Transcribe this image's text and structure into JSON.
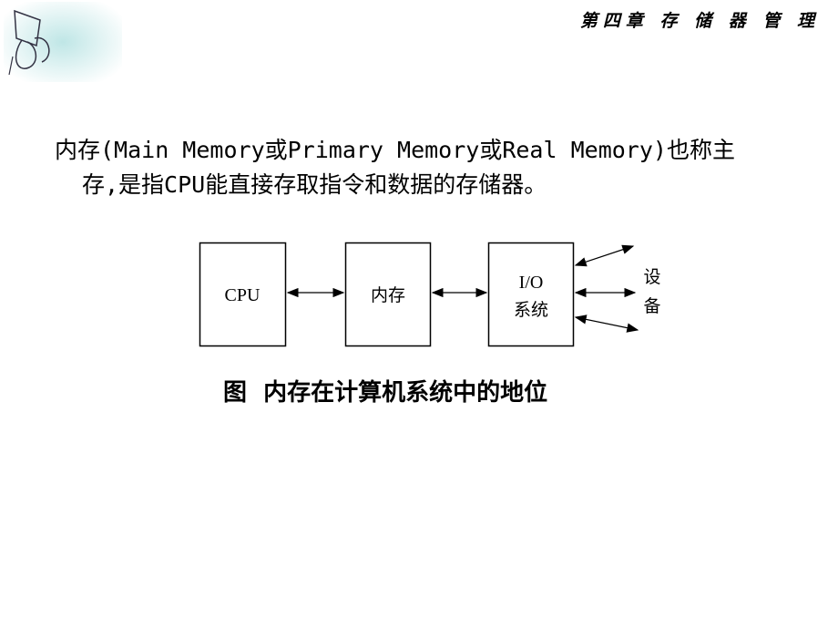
{
  "header": {
    "chapter_title": "第四章 存 储 器 管 理"
  },
  "body": {
    "line1": "内存(Main Memory或Primary Memory或Real Memory)也称主",
    "line2": "存,是指CPU能直接存取指令和数据的存储器。"
  },
  "diagram": {
    "cpu": "CPU",
    "memory": "内存",
    "io_line1": "I/O",
    "io_line2": "系统",
    "device_1": "设",
    "device_2": "备"
  },
  "caption": "图  内存在计算机系统中的地位"
}
